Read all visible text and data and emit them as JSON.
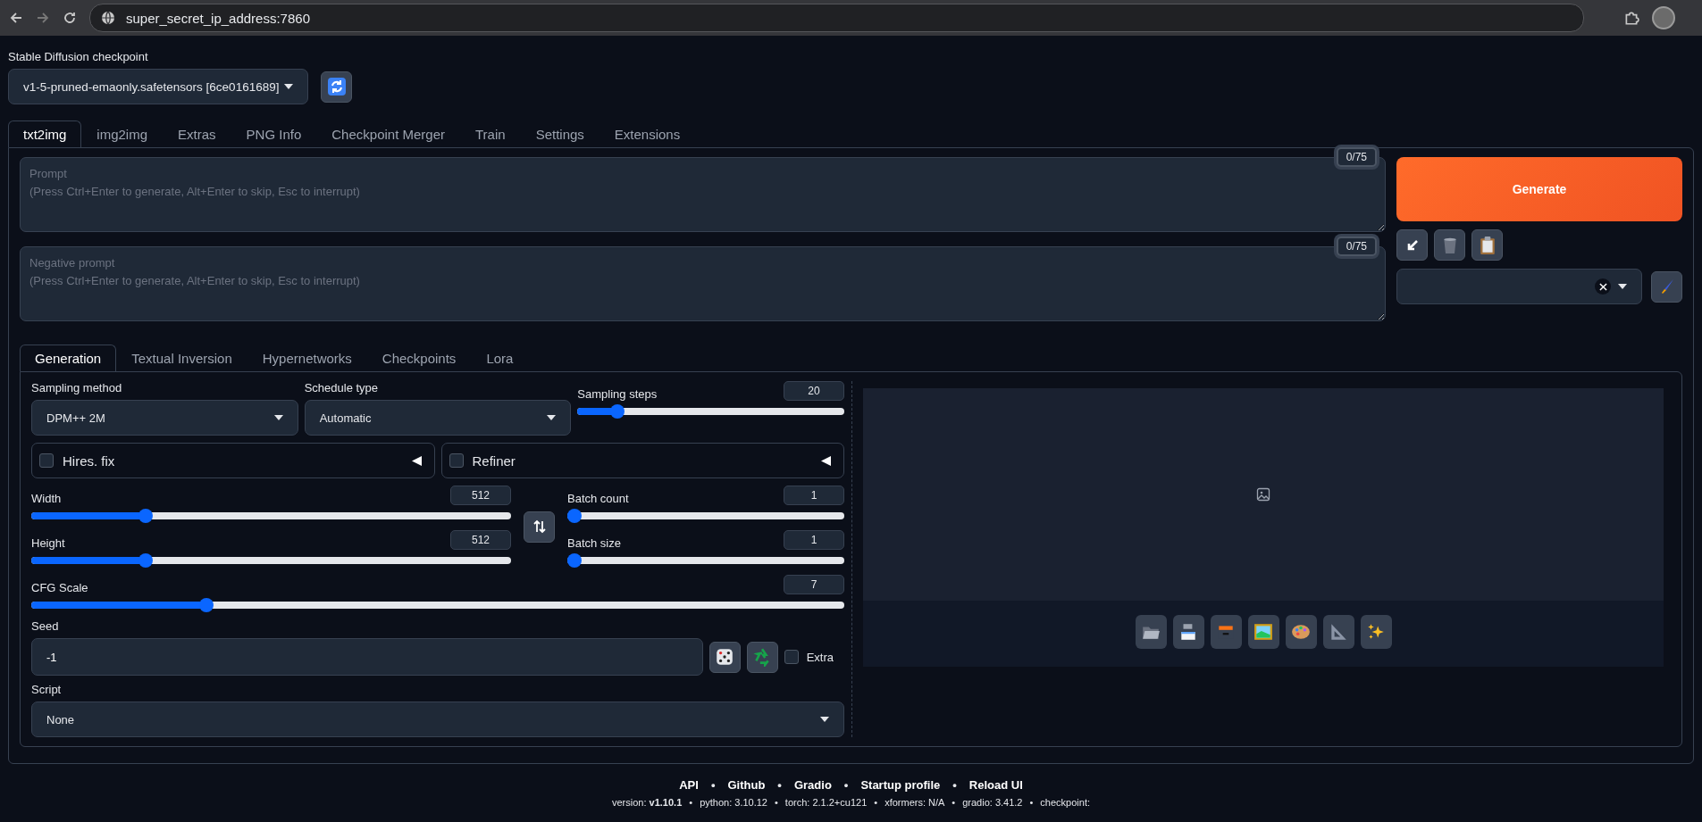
{
  "browser": {
    "url": "super_secret_ip_address:7860"
  },
  "checkpoint": {
    "label": "Stable Diffusion checkpoint",
    "value": "v1-5-pruned-emaonly.safetensors [6ce0161689]"
  },
  "tabs": [
    {
      "label": "txt2img",
      "selected": true
    },
    {
      "label": "img2img",
      "selected": false
    },
    {
      "label": "Extras",
      "selected": false
    },
    {
      "label": "PNG Info",
      "selected": false
    },
    {
      "label": "Checkpoint Merger",
      "selected": false
    },
    {
      "label": "Train",
      "selected": false
    },
    {
      "label": "Settings",
      "selected": false
    },
    {
      "label": "Extensions",
      "selected": false
    }
  ],
  "prompt": {
    "placeholder": "Prompt\n(Press Ctrl+Enter to generate, Alt+Enter to skip, Esc to interrupt)",
    "counter": "0/75"
  },
  "negative_prompt": {
    "placeholder": "Negative prompt\n(Press Ctrl+Enter to generate, Alt+Enter to skip, Esc to interrupt)",
    "counter": "0/75"
  },
  "generate_button": "Generate",
  "subtabs": [
    {
      "label": "Generation",
      "selected": true
    },
    {
      "label": "Textual Inversion",
      "selected": false
    },
    {
      "label": "Hypernetworks",
      "selected": false
    },
    {
      "label": "Checkpoints",
      "selected": false
    },
    {
      "label": "Lora",
      "selected": false
    }
  ],
  "sampling_method": {
    "label": "Sampling method",
    "value": "DPM++ 2M"
  },
  "schedule_type": {
    "label": "Schedule type",
    "value": "Automatic"
  },
  "sampling_steps": {
    "label": "Sampling steps",
    "value": "20",
    "level": 0.13
  },
  "accordions": [
    {
      "label": "Hires. fix",
      "checked": false,
      "expanded": false
    },
    {
      "label": "Refiner",
      "checked": false,
      "expanded": false
    }
  ],
  "width": {
    "label": "Width",
    "value": "512",
    "level": 0.23
  },
  "height": {
    "label": "Height",
    "value": "512",
    "level": 0.23
  },
  "batch_count": {
    "label": "Batch count",
    "value": "1",
    "level": 0
  },
  "batch_size": {
    "label": "Batch size",
    "value": "1",
    "level": 0
  },
  "cfg_scale": {
    "label": "CFG Scale",
    "value": "7",
    "level": 0.21
  },
  "seed": {
    "label": "Seed",
    "value": "-1"
  },
  "extra": {
    "label": "Extra",
    "checked": false
  },
  "script": {
    "label": "Script",
    "value": "None"
  },
  "footer": {
    "separator": "•",
    "links": [
      "API",
      "Github",
      "Gradio",
      "Startup profile",
      "Reload UI"
    ],
    "info": [
      "version: **v1.10.1**",
      "python: 3.10.12",
      "torch: 2.1.2+cu121",
      "xformers: N/A",
      "gradio: 3.41.2",
      "checkpoint:"
    ]
  }
}
